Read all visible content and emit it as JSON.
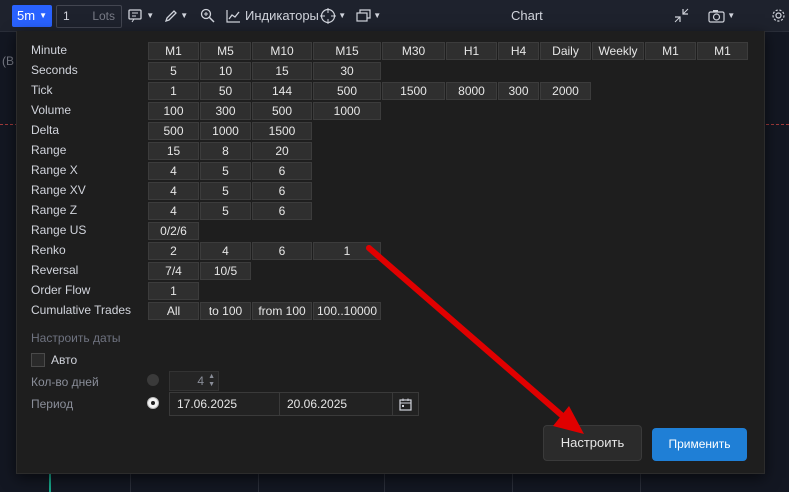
{
  "toolbar": {
    "timeframe": "5m",
    "quantity": "1",
    "quantity_unit": "Lots",
    "indicators_label": "Индикаторы",
    "chart_title": "Chart",
    "icons": [
      "caret-down-icon",
      "candles-icon",
      "pencil-icon",
      "zoom-icon",
      "line-chart-icon",
      "crosshair-icon",
      "layers-icon",
      "collapse-icon",
      "camera-icon",
      "settings-icon"
    ]
  },
  "chart": {
    "left_label": "(B"
  },
  "dialog": {
    "rows": [
      {
        "label": "Minute",
        "values": [
          "M1",
          "M5",
          "M10",
          "M15",
          "M30",
          "H1",
          "H4",
          "Daily",
          "Weekly",
          "M1",
          "M1"
        ]
      },
      {
        "label": "Seconds",
        "values": [
          "5",
          "10",
          "15",
          "30"
        ]
      },
      {
        "label": "Tick",
        "values": [
          "1",
          "50",
          "144",
          "500",
          "1500",
          "8000",
          "300",
          "2000"
        ]
      },
      {
        "label": "Volume",
        "values": [
          "100",
          "300",
          "500",
          "1000"
        ]
      },
      {
        "label": "Delta",
        "values": [
          "500",
          "1000",
          "1500"
        ]
      },
      {
        "label": "Range",
        "values": [
          "15",
          "8",
          "20"
        ]
      },
      {
        "label": "Range X",
        "values": [
          "4",
          "5",
          "6"
        ]
      },
      {
        "label": "Range XV",
        "values": [
          "4",
          "5",
          "6"
        ]
      },
      {
        "label": "Range Z",
        "values": [
          "4",
          "5",
          "6"
        ]
      },
      {
        "label": "Range US",
        "values": [
          "0/2/6"
        ]
      },
      {
        "label": "Renko",
        "values": [
          "2",
          "4",
          "6",
          "1"
        ]
      },
      {
        "label": "Reversal",
        "values": [
          "7/4",
          "10/5"
        ]
      },
      {
        "label": "Order Flow",
        "values": [
          "1"
        ]
      },
      {
        "label": "Cumulative Trades",
        "values": [
          "All",
          "to 100",
          "from 100",
          "100..10000"
        ]
      }
    ],
    "dates_section_title": "Настроить даты",
    "auto_label": "Авто",
    "days_label": "Кол-во дней",
    "days_value": "4",
    "period_label": "Период",
    "date_from": "17.06.2025",
    "date_to": "20.06.2025",
    "setup_button": "Настроить",
    "apply_button": "Применить"
  },
  "colors": {
    "accent": "#2962ff",
    "apply": "#1f7fd6",
    "arrow": "#e00000"
  }
}
